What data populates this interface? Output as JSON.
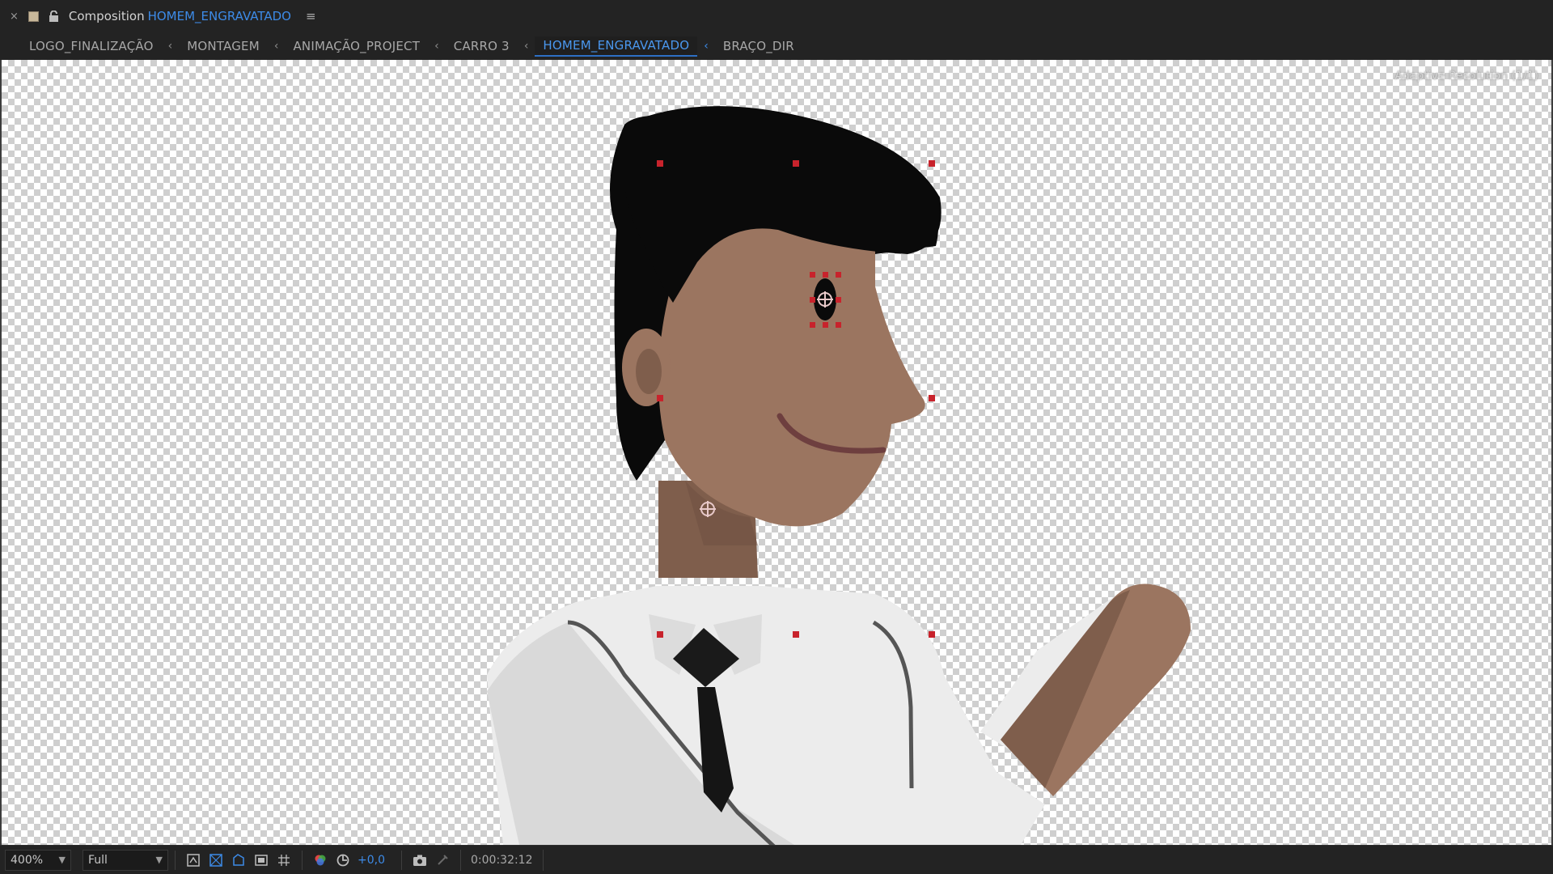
{
  "header": {
    "label": "Composition",
    "comp_name": "HOMEM_ENGRAVATADO",
    "close_icon": "×",
    "menu_icon": "≡"
  },
  "breadcrumb": {
    "items": [
      {
        "label": "LOGO_FINALIZAÇÃO"
      },
      {
        "label": "MONTAGEM"
      },
      {
        "label": "ANIMAÇÃO_PROJECT"
      },
      {
        "label": "CARRO 3"
      },
      {
        "label": "HOMEM_ENGRAVATADO",
        "active": true
      },
      {
        "label": "BRAÇO_DIR"
      }
    ],
    "separator": "‹"
  },
  "viewer": {
    "adaptive_resolution": "Adaptive Resolution (1/1)"
  },
  "toolbar": {
    "zoom": "400%",
    "resolution": "Full",
    "exposure": "+0,0",
    "timecode": "0:00:32:12"
  },
  "colors": {
    "accent": "#3d8be8",
    "skin": "#9b7560",
    "hair": "#0a0a0a",
    "shirt": "#ececec",
    "handle": "#c8232c"
  }
}
